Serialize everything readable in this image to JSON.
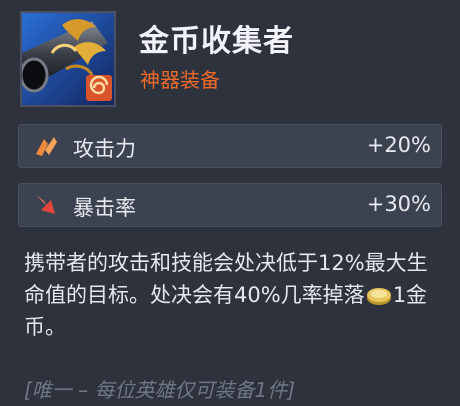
{
  "item": {
    "name": "金币收集者",
    "type": "神器装备",
    "icon": "gold-collector-gun-icon"
  },
  "stats": [
    {
      "label": "攻击力",
      "value": "+20%",
      "icon": "attack-damage-icon",
      "color": "#f08a3c"
    },
    {
      "label": "暴击率",
      "value": "+30%",
      "icon": "crit-chance-icon",
      "color": "#e2463c"
    }
  ],
  "description": {
    "part1": "携带者的攻击和技能会处决低于12%最大生命值的目标。处决会有40%几率掉落",
    "part2": "1金币。",
    "inline_icon": "gold-coin-icon"
  },
  "unique_text": "[唯一 – 每位英雄仅可装备1件]",
  "colors": {
    "background": "#2d323d",
    "accent": "#ef6a2a",
    "stat_bg": "#3c4250"
  }
}
